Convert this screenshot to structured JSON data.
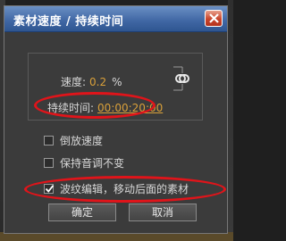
{
  "dialog": {
    "title": "素材速度 / 持续时间",
    "close_icon": "close-icon"
  },
  "speed": {
    "label": "速度:",
    "value": "0.2",
    "unit": "%"
  },
  "duration": {
    "label": "持续时间:",
    "value": "00:00:20:00"
  },
  "options": {
    "reverse_speed": {
      "label": "倒放速度",
      "checked": false
    },
    "maintain_pitch": {
      "label": "保持音调不变",
      "checked": false
    },
    "ripple_edit": {
      "label": "波纹编辑，移动后面的素材",
      "checked": true
    }
  },
  "buttons": {
    "ok_label": "确定",
    "cancel_label": "取消"
  },
  "colors": {
    "title_bar": "#3f66a3",
    "value_text": "#d9a03a",
    "annotation_red": "#e0141a"
  }
}
